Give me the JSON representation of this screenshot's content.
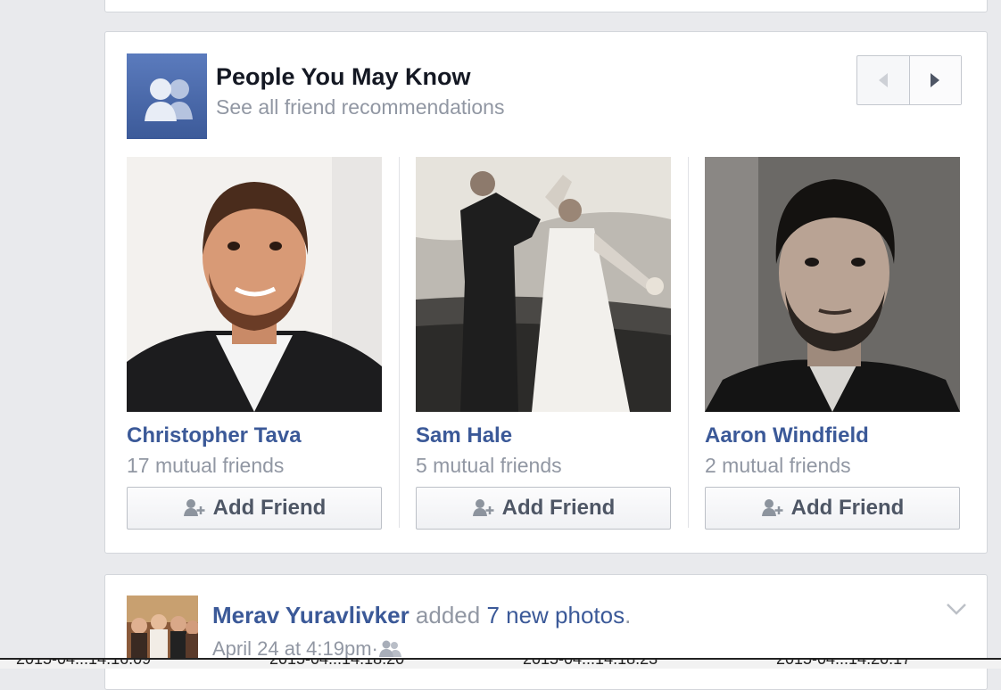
{
  "pymk": {
    "title": "People You May Know",
    "subtitle": "See all friend recommendations",
    "people": [
      {
        "name": "Christopher Tava",
        "mutual": "17 mutual friends",
        "button": "Add Friend"
      },
      {
        "name": "Sam Hale",
        "mutual": "5 mutual friends",
        "button": "Add Friend"
      },
      {
        "name": "Aaron Windfield",
        "mutual": "2 mutual friends",
        "button": "Add Friend"
      }
    ]
  },
  "post": {
    "author": "Merav Yuravlivker",
    "action": " added ",
    "photos": "7 new photos",
    "punct": ".",
    "time": "April 24 at 4:19pm",
    "sep": " · "
  },
  "strip": {
    "labels": [
      "2015-04...14.16.09",
      "2015-04...14.18.20",
      "2015-04...14.18.23",
      "2015-04...14.20.17"
    ]
  },
  "colors": {
    "link": "#3b5998",
    "muted": "#9197a3",
    "page_bg": "#e9eaed"
  }
}
